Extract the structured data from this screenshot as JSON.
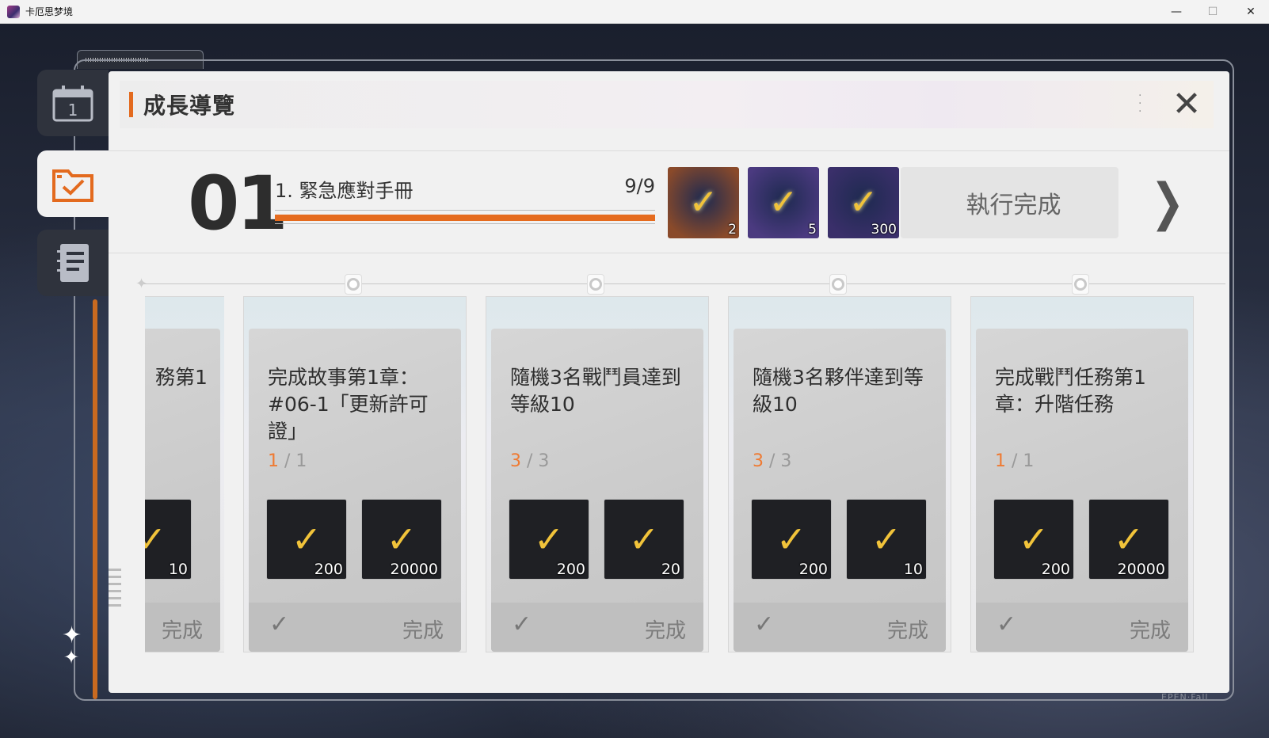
{
  "window": {
    "title": "卡厄思梦境",
    "minimize": "—",
    "maximize": "☐",
    "close": "✕"
  },
  "panel": {
    "title": "成長導覽",
    "close_glyph": "✕"
  },
  "sidenav": [
    {
      "name": "calendar",
      "icon": "calendar-icon",
      "label": "1"
    },
    {
      "name": "growth-guide",
      "icon": "checklist-folder-icon",
      "active": true
    },
    {
      "name": "notebook",
      "icon": "notebook-icon"
    }
  ],
  "chapter": {
    "number": "01",
    "name": "1. 緊急應對手冊",
    "progress_text": "9/9",
    "progress": 1.0,
    "rewards": [
      {
        "icon": "planet-orb-icon",
        "qty": "2",
        "color": "#8a4a2a"
      },
      {
        "icon": "gear-orb-icon",
        "qty": "5",
        "color": "#4b3a80"
      },
      {
        "icon": "crystal-star-icon",
        "qty": "300",
        "color": "#3a2f6a"
      }
    ],
    "complete_label": "執行完成",
    "next_glyph": "❯"
  },
  "cards": [
    {
      "desc": "務第1",
      "cur": "",
      "total": "",
      "rewards": [
        {
          "icon": "ticket-icon",
          "qty": "10"
        }
      ],
      "tick": "",
      "status": "完成",
      "partial": true
    },
    {
      "desc": "完成故事第1章：#06-1「更新許可證」",
      "cur": "1",
      "total": "/ 1",
      "rewards": [
        {
          "icon": "book-icon",
          "qty": "200"
        },
        {
          "icon": "gold-crystal-icon",
          "qty": "20000"
        }
      ],
      "tick": "✓",
      "status": "完成"
    },
    {
      "desc": "隨機3名戰鬥員達到等級10",
      "cur": "3",
      "total": "/ 3",
      "rewards": [
        {
          "icon": "book-icon",
          "qty": "200"
        },
        {
          "icon": "ticket-icon",
          "qty": "20"
        }
      ],
      "tick": "✓",
      "status": "完成"
    },
    {
      "desc": "隨機3名夥伴達到等級10",
      "cur": "3",
      "total": "/ 3",
      "rewards": [
        {
          "icon": "book-icon",
          "qty": "200"
        },
        {
          "icon": "ticket-icon",
          "qty": "10"
        }
      ],
      "tick": "✓",
      "status": "完成"
    },
    {
      "desc": "完成戰鬥任務第1章：升階任務",
      "cur": "1",
      "total": "/ 1",
      "rewards": [
        {
          "icon": "book-icon",
          "qty": "200"
        },
        {
          "icon": "gold-crystal-icon",
          "qty": "20000"
        }
      ],
      "tick": "✓",
      "status": "完成"
    }
  ],
  "brand": "EPEN·Fall",
  "colors": {
    "accent": "#e36a1e",
    "check": "#f1c33a",
    "count_current": "#ef7a32"
  }
}
